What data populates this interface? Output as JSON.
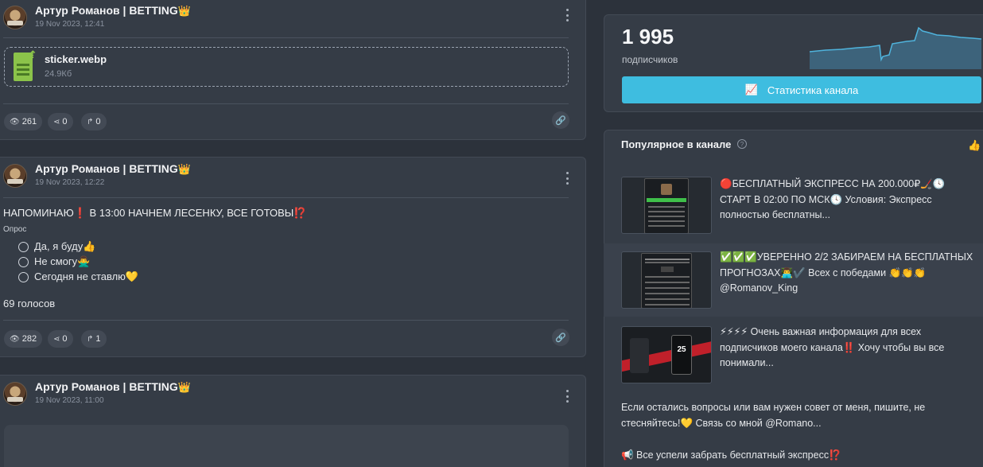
{
  "posts": [
    {
      "author": "Артур Романов | BETTING",
      "crown": "👑",
      "date": "19 Nov 2023, 12:41",
      "file": {
        "name": "sticker.webp",
        "size": "24.9Кб"
      },
      "views": "261",
      "shares": "0",
      "forwards": "0"
    },
    {
      "author": "Артур Романов | BETTING",
      "crown": "👑",
      "date": "19 Nov 2023, 12:22",
      "text": "НАПОМИНАЮ❗ В 13:00 НАЧНЕМ ЛЕСЕНКУ, ВСЕ ГОТОВЫ⁉️",
      "poll_label": "Опрос",
      "poll_options": [
        "Да, я буду👍",
        "Не смогу🙅‍♂️",
        "Сегодня не ставлю💛"
      ],
      "votes": "69 голосов",
      "views": "282",
      "shares": "0",
      "forwards": "1"
    },
    {
      "author": "Артур Романов | BETTING",
      "crown": "👑",
      "date": "19 Nov 2023, 11:00"
    }
  ],
  "sidebar": {
    "subscribers_count": "1 995",
    "subscribers_label": "подписчиков",
    "stats_button": "Статистика канала",
    "popular_title": "Популярное в канале",
    "popular": [
      {
        "text": "🔴БЕСПЛАТНЫЙ ЭКСПРЕСС НА 200.000₽🏒🕓 СТАРТ В 02:00 ПО МСК🕓 Условия: Экспресс полностью бесплатны..."
      },
      {
        "text": "✅✅✅УВЕРЕННО 2/2 ЗАБИРАЕМ НА БЕСПЛАТНЫХ ПРОГНОЗАХ👨‍💻✔️ Всех с победами 👏👏👏 @Romanov_King"
      },
      {
        "text": "⚡⚡⚡⚡ Очень важная информация для всех подписчиков моего канала‼️ Хочу чтобы вы все понимали..."
      }
    ],
    "extra_text_1": "Если остались вопросы или вам нужен совет от меня, пишите, не стесняйтесь!💛 Связь со мной @Romano...",
    "extra_text_2": "📢 Все успели забрать бесплатный экспресс⁉️"
  },
  "icons": {
    "views": "eye-icon",
    "shares": "share-icon",
    "forwards": "forward-icon",
    "link": "link-icon",
    "chart": "chart-icon",
    "info": "info-icon",
    "like": "thumbs-up-icon"
  },
  "colors": {
    "accent": "#3ebde0",
    "background": "#2c323b",
    "card": "#353c46"
  }
}
